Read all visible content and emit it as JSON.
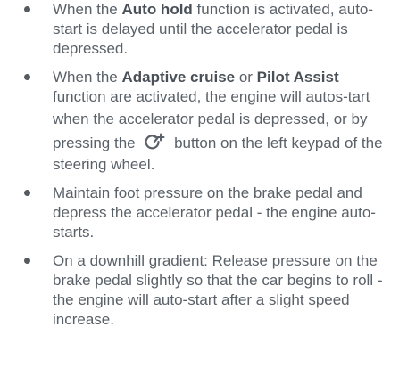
{
  "items": [
    {
      "t0": "When the ",
      "b0": "Auto hold",
      "t1": " function is activated, auto-start is delayed until the accelerator pedal is depressed."
    },
    {
      "t0": "When the ",
      "b0": "Adaptive cruise",
      "t1": " or ",
      "b1": "Pilot Assist",
      "t2": " function are activated, the engine will autos-tart when the accelerator pedal is depressed,",
      "t3": "or by pressing the ",
      "icon": "restart-arrow-icon",
      "t4": " button on the left keypad of the steering wheel."
    },
    {
      "t0": "Maintain foot pressure on the brake pedal and depress the accelerator pedal - the engine auto-starts."
    },
    {
      "t0": "On a downhill gradient: Release pressure on the brake pedal slightly so that the car begins to roll - the engine will auto-start after a slight speed increase."
    }
  ]
}
